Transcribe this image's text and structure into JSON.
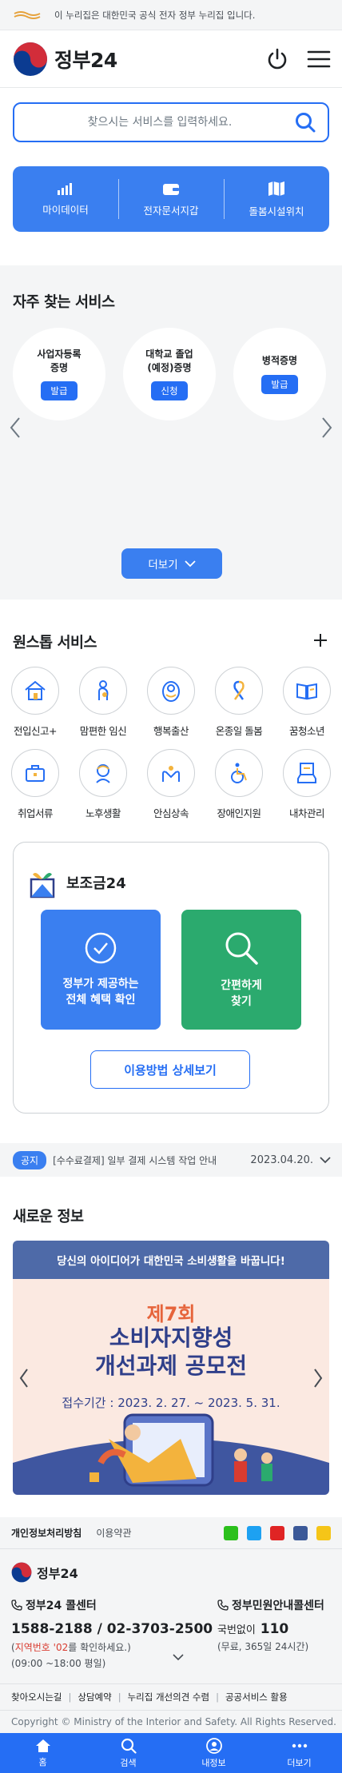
{
  "gov_banner": {
    "text": "이 누리집은 대한민국 공식 전자 정부 누리집 입니다.",
    "logo_icon": "eg-logo-icon"
  },
  "header": {
    "brand": "정부24",
    "logo_icon": "taegeuk-logo-icon",
    "power_icon": "power-icon",
    "menu_icon": "hamburger-menu-icon"
  },
  "search": {
    "placeholder": "찾으시는 서비스를 입력하세요.",
    "icon": "search-icon"
  },
  "quick_menu": [
    {
      "label": "마이데이터",
      "icon": "bar-chart-icon"
    },
    {
      "label": "전자문서지갑",
      "icon": "wallet-icon"
    },
    {
      "label": "돌봄시설위치",
      "icon": "map-icon"
    }
  ],
  "frequent": {
    "title": "자주 찾는 서비스",
    "items": [
      {
        "name": "사업자등록\n증명",
        "action": "발급"
      },
      {
        "name": "대학교 졸업\n(예정)증명",
        "action": "신청"
      },
      {
        "name": "병적증명",
        "action": "발급"
      }
    ],
    "more_label": "더보기"
  },
  "onestop": {
    "title": "원스톱 서비스",
    "items": [
      {
        "label": "전입신고+",
        "icon": "house-icon"
      },
      {
        "label": "맘편한 임신",
        "icon": "pregnancy-icon"
      },
      {
        "label": "행복출산",
        "icon": "baby-icon"
      },
      {
        "label": "온종일 돌봄",
        "icon": "ribbon-icon"
      },
      {
        "label": "꿈청소년",
        "icon": "book-icon"
      },
      {
        "label": "취업서류",
        "icon": "briefcase-icon"
      },
      {
        "label": "노후생활",
        "icon": "elderly-icon"
      },
      {
        "label": "안심상속",
        "icon": "family-icon"
      },
      {
        "label": "장애인지원",
        "icon": "wheelchair-icon"
      },
      {
        "label": "내차관리",
        "icon": "car-document-icon"
      }
    ]
  },
  "subsidy": {
    "title": "보조금24",
    "box1": "정부가 제공하는\n전체 혜택 확인",
    "box2": "간편하게\n찾기",
    "detail_label": "이용방법 상세보기"
  },
  "notice": {
    "badge": "공지",
    "text": "[수수료결제] 일부 결제 시스템 작업 안내",
    "date": "2023.04.20."
  },
  "new_info": {
    "title": "새로운 정보",
    "banner": {
      "header": "당신의 아이디어가 대한민국 소비생활을 바꿉니다!",
      "line1": "제7회",
      "line2": "소비자지향성\n개선과제 공모전",
      "period": "접수기간 : 2023. 2. 27. ~ 2023. 5. 31."
    }
  },
  "footer": {
    "privacy": "개인정보처리방침",
    "terms": "이용약관",
    "brand": "정부24",
    "cc1": {
      "title": "정부24 콜센터",
      "number": "1588-2188 / 02-3703-2500",
      "note_prefix": "(",
      "note_red": "지역번호 '02",
      "note_suffix": "를 확인하세요.)",
      "hours": "(09:00 ~18:00 평일)"
    },
    "cc2": {
      "title": "정부민원안내콜센터",
      "number_prefix": "국번없이",
      "number": "110",
      "hours": "(무료, 365일 24시간)"
    },
    "links": [
      "찾아오시는길",
      "상담예약",
      "누리집 개선의견 수렴",
      "공공서비스 활용"
    ],
    "copyright": "Copyright © Ministry of the Interior and Safety. All Rights Reserved."
  },
  "bottom_nav": [
    {
      "label": "홈",
      "icon": "home-icon"
    },
    {
      "label": "검색",
      "icon": "search-icon"
    },
    {
      "label": "내정보",
      "icon": "user-icon"
    },
    {
      "label": "더보기",
      "icon": "more-dots-icon"
    }
  ],
  "colors": {
    "primary": "#256ef4",
    "accent_blue": "#3a7ff0",
    "green": "#2baa6e"
  }
}
